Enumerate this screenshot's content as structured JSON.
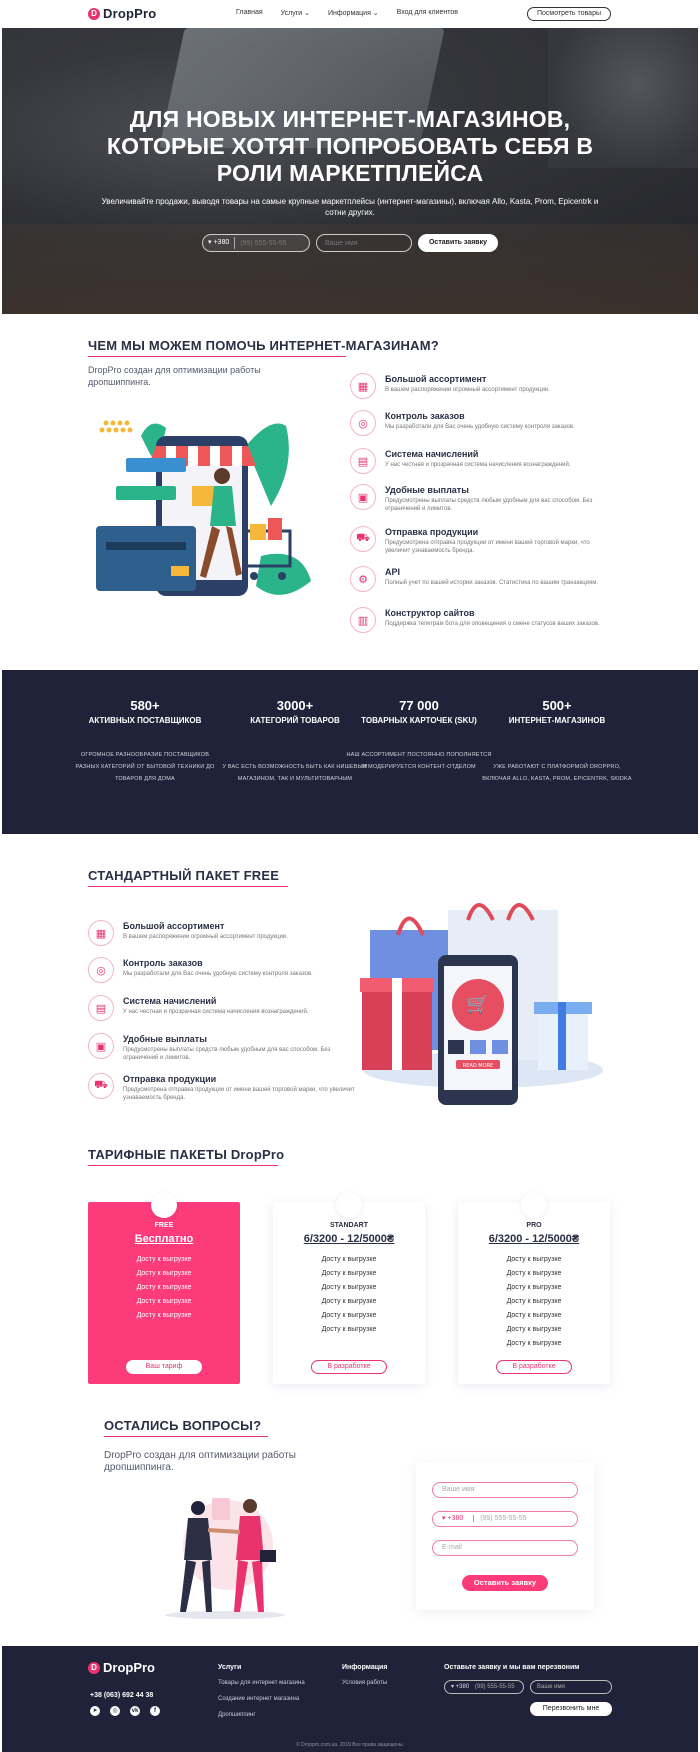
{
  "header": {
    "logo_mark": "D",
    "logo_text": "DropPro",
    "nav": [
      "Главная",
      "Услуги ⌄",
      "Информация ⌄",
      "Вход для клиентов"
    ],
    "cta": "Посмотреть товары"
  },
  "hero": {
    "title_line1": "ДЛЯ НОВЫХ ИНТЕРНЕТ-МАГАЗИНОВ,",
    "title_line2": "КОТОРЫЕ ХОТЯТ ПОПРОБОВАТЬ СЕБЯ В",
    "title_line3": "РОЛИ МАРКЕТПЛЕЙСА",
    "subtitle": "Увеличивайте продажи, выводя товары на самые крупные маркетплейсы (интернет-магазины), включая Allo, Kasta, Prom, Epicentrk и сотни других.",
    "phone_code": "▾ +380",
    "phone_placeholder": "(99) 555-55-55",
    "name_placeholder": "Ваше имя",
    "submit": "Оставить заявку"
  },
  "help": {
    "title": "ЧЕМ МЫ МОЖЕМ ПОМОЧЬ ИНТЕРНЕТ-МАГАЗИНАМ?",
    "subtitle": "DropPro создан для оптимизации работы дропшиппинга.",
    "features": [
      {
        "title": "Большой ассортимент",
        "desc": "В вашем распоряжении огромный ассортимент продукции."
      },
      {
        "title": "Контроль заказов",
        "desc": "Мы разработали для Вас очень удобную систему контроля заказов."
      },
      {
        "title": "Система начислений",
        "desc": "У нас честная и прозрачная система начисления вознаграждений."
      },
      {
        "title": "Удобные выплаты",
        "desc": "Предусмотрены выплаты средств любым удобным для вас способом. Без ограничений и лимитов."
      },
      {
        "title": "Отправка продукции",
        "desc": "Предусмотрена отправка продукции от имени вашей торговой марки, что увеличит узнаваемость бренда."
      },
      {
        "title": "API",
        "desc": "Полный учет по вашей истории заказов. Статистика по вашим транзакциям."
      },
      {
        "title": "Конструктор сайтов",
        "desc": "Поддержка телеграм бота для оповещения о смене статусов ваших заказов."
      }
    ]
  },
  "stats": [
    {
      "number": "580+",
      "label": "АКТИВНЫХ ПОСТАВЩИКОВ",
      "desc": "ОГРОМНОЕ РАЗНООБРАЗИЕ ПОСТАВЩИКОВ РАЗНЫХ КАТЕГОРИЙ ОТ БЫТОВОЙ ТЕХНИКИ ДО ТОВАРОВ ДЛЯ ДОМА"
    },
    {
      "number": "3000+",
      "label": "КАТЕГОРИЙ ТОВАРОВ",
      "desc": "У ВАС ЕСТЬ ВОЗМОЖНОСТЬ БЫТЬ КАК НИШЕВЫМ МАГАЗИНОМ, ТАК И МУЛЬТИТОВАРНЫМ"
    },
    {
      "number": "77 000",
      "label": "ТОВАРНЫХ КАРТОЧЕК (SKU)",
      "desc": "НАШ АССОРТИМЕНТ ПОСТОЯННО ПОПОЛНЯЕТСЯ И МОДЕРИРУЕТСЯ КОНТЕНТ-ОТДЕЛОМ"
    },
    {
      "number": "500+",
      "label": "ИНТЕРНЕТ-МАГАЗИНОВ",
      "desc": "УЖЕ РАБОТАЮТ С ПЛАТФОРМОЙ DROPPRO, ВКЛЮЧАЯ ALLO, KASTA, PROM, EPICENTRK, SKIDKA"
    }
  ],
  "free": {
    "title": "СТАНДАРТНЫЙ ПАКЕТ FREE",
    "features": [
      {
        "title": "Большой ассортимент",
        "desc": "В вашем распоряжении огромный ассортимент продукции."
      },
      {
        "title": "Контроль заказов",
        "desc": "Мы разработали для Вас очень удобную систему контроля заказов."
      },
      {
        "title": "Система начислений",
        "desc": "У нас честная и прозрачная система начисления вознаграждений."
      },
      {
        "title": "Удобные выплаты",
        "desc": "Предусмотрены выплаты средств любым удобным для вас способом. Без ограничений и лимитов."
      },
      {
        "title": "Отправка продукции",
        "desc": "Предусмотрена отправка продукции от имени вашей торговой марки, что увеличит узнаваемость бренда."
      }
    ],
    "phone_screen_btn": "READ MORE"
  },
  "pricing": {
    "title": "ТАРИФНЫЕ ПАКЕТЫ DropPro",
    "plans": [
      {
        "tier": "FREE",
        "price": "Бесплатно",
        "items": [
          "Досту к выгрузке",
          "Досту к выгрузке",
          "Досту к выгрузке",
          "Досту к выгрузке",
          "Досту к выгрузке"
        ],
        "button": "Ваш тариф"
      },
      {
        "tier": "STANDART",
        "price": "6/3200 - 12/5000₴",
        "items": [
          "Досту к выгрузке",
          "Досту к выгрузке",
          "Досту к выгрузке",
          "Досту к выгрузке",
          "Досту к выгрузке",
          "Досту к выгрузке"
        ],
        "button": "В разработке"
      },
      {
        "tier": "PRO",
        "price": "6/3200 - 12/5000₴",
        "items": [
          "Досту к выгрузке",
          "Досту к выгрузке",
          "Досту к выгрузке",
          "Досту к выгрузке",
          "Досту к выгрузке",
          "Досту к выгрузке",
          "Досту к выгрузке"
        ],
        "button": "В разработке"
      }
    ]
  },
  "contact": {
    "title": "ОСТАЛИСЬ ВОПРОСЫ?",
    "subtitle": "DropPro создан для оптимизации работы дропшиппинга.",
    "name_placeholder": "Ваше имя",
    "phone_code": "▾ +380",
    "phone_placeholder": "(99) 555-55-55",
    "email_placeholder": "E-mail",
    "submit": "Оставить заявку"
  },
  "footer": {
    "logo_text": "DropPro",
    "phone": "+38 (063) 692 44 38",
    "services_title": "Услуги",
    "services": [
      "Товары для интернет магазина",
      "Создание интернет магазина",
      "Дропшиппинг"
    ],
    "info_title": "Информация",
    "info": [
      "Условия работы"
    ],
    "callback_title": "Оставьте заявку и мы вам перезвоним",
    "phone_code": "▾ +380",
    "phone_placeholder": "(99) 555-55-55",
    "name_placeholder": "Ваше имя",
    "callback_button": "Перезвонить мне",
    "copyright": "© Droppro.com.ua. 2019 Все права защищены.",
    "social_icons": [
      "telegram-icon",
      "instagram-icon",
      "vk-icon",
      "facebook-icon"
    ]
  }
}
